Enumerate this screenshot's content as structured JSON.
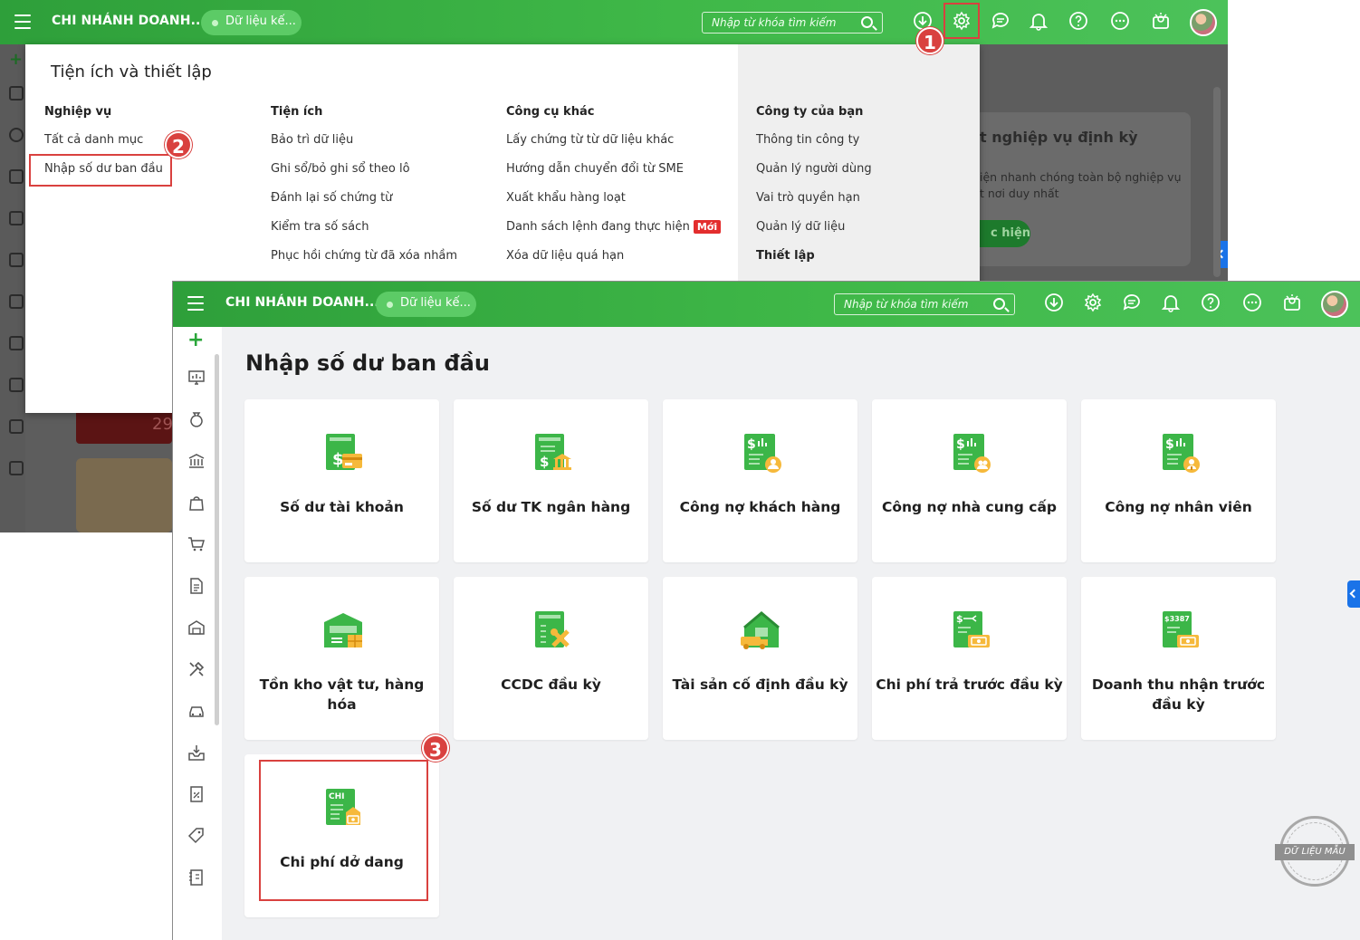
{
  "header": {
    "branch_name": "CHI NHÁNH DOANH...",
    "data_label": "Dữ liệu kế...",
    "search_placeholder": "Nhập từ khóa tìm kiếm"
  },
  "settings_panel": {
    "title": "Tiện ích và thiết lập",
    "columns": [
      {
        "heading": "Nghiệp vụ",
        "items": [
          "Tất cả danh mục",
          "Nhập số dư ban đầu"
        ]
      },
      {
        "heading": "Tiện ích",
        "items": [
          "Bảo trì dữ liệu",
          "Ghi sổ/bỏ ghi sổ theo lô",
          "Đánh lại số chứng từ",
          "Kiểm tra số sách",
          "Phục hồi chứng từ đã xóa nhầm"
        ]
      },
      {
        "heading": "Công cụ khác",
        "items": [
          "Lấy chứng từ từ dữ liệu khác",
          "Hướng dẫn chuyển đổi từ SME",
          "Xuất khẩu hàng loạt",
          "Danh sách lệnh đang thực hiện",
          "Xóa dữ liệu quá hạn"
        ],
        "new_badge": "Mới"
      },
      {
        "heading": "Công ty của bạn",
        "items": [
          "Thông tin công ty",
          "Quản lý người dùng",
          "Vai trò quyền hạn",
          "Quản lý dữ liệu"
        ],
        "subheading": "Thiết lập"
      }
    ]
  },
  "background_page": {
    "card_title": "t nghiệp vụ định kỳ",
    "card_desc_1": "iện nhanh chóng toàn bộ nghiệp vụ",
    "card_desc_2": "t nơi duy nhất",
    "card_button": "c hiện",
    "tile_number": "29"
  },
  "steps": [
    "1",
    "2",
    "3"
  ],
  "page": {
    "title": "Nhập số dư ban đầu",
    "cards": [
      {
        "label": "Số dư tài khoản",
        "icon": "account-balance-icon"
      },
      {
        "label": "Số dư TK ngân hàng",
        "icon": "bank-balance-icon"
      },
      {
        "label": "Công nợ khách hàng",
        "icon": "customer-debt-icon"
      },
      {
        "label": "Công nợ nhà cung cấp",
        "icon": "supplier-debt-icon"
      },
      {
        "label": "Công nợ nhân viên",
        "icon": "employee-debt-icon"
      },
      {
        "label": "Tồn kho vật tư, hàng hóa",
        "icon": "warehouse-icon"
      },
      {
        "label": "CCDC đầu kỳ",
        "icon": "tools-icon"
      },
      {
        "label": "Tài sản cố định đầu kỳ",
        "icon": "fixed-asset-icon"
      },
      {
        "label": "Chi phí trả trước đầu kỳ",
        "icon": "prepaid-expense-icon"
      },
      {
        "label": "Doanh thu nhận trước đầu kỳ",
        "icon": "deferred-revenue-icon"
      },
      {
        "label": "Chi phí dở dang",
        "icon": "wip-cost-icon"
      }
    ]
  },
  "watermark": "DỮ LIỆU MẪU",
  "colors": {
    "brand_green": "#3cb648",
    "highlight_red": "#d9413f",
    "new_badge": "#e32d2d"
  }
}
